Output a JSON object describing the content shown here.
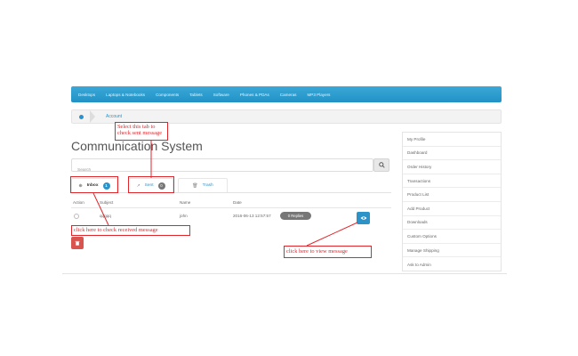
{
  "nav": {
    "items": [
      "Desktops",
      "Laptops & Notebooks",
      "Components",
      "Tablets",
      "Software",
      "Phones & PDAs",
      "Cameras",
      "MP3 Players"
    ]
  },
  "breadcrumb": {
    "account": "Account"
  },
  "page": {
    "title": "Communication System"
  },
  "search": {
    "placeholder": "Search"
  },
  "tabs": [
    {
      "label": "Inbox",
      "count": "1"
    },
    {
      "label": "Sent",
      "count": "0"
    },
    {
      "label": "Trash",
      "count": ""
    }
  ],
  "table": {
    "headers": [
      "Action",
      "Subject",
      "Name",
      "Date"
    ],
    "rows": [
      {
        "subject": "qqqqq",
        "name": "john",
        "date": "2016-06-13 12:57:57",
        "replies": "0 Replies"
      }
    ]
  },
  "side_menu": {
    "items": [
      "My Profile",
      "Dashboard",
      "Order History",
      "Transactions",
      "Product List",
      "Add Product",
      "Downloads",
      "Custom Options",
      "Manage Shipping",
      "Ask to Admin"
    ]
  },
  "annotations": {
    "sent": "Select this tab to check sent message",
    "received": "click here to check received message",
    "view": "click here to view message"
  },
  "colors": {
    "nav": "#2292c6",
    "accent": "#2b93c8",
    "annotation": "#e0262b",
    "delete": "#d9534f"
  }
}
